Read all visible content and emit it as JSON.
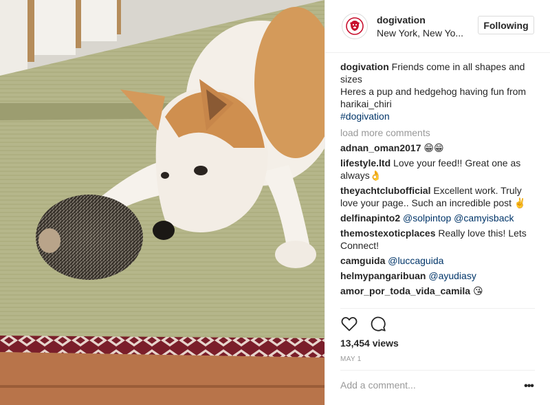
{
  "header": {
    "username": "dogivation",
    "location": "New York, New Yo...",
    "follow_label": "Following",
    "avatar_icon": "dog-logo-icon",
    "brand_color": "#c8102e"
  },
  "caption": {
    "username": "dogivation",
    "line1": "Friends come in all shapes and sizes",
    "line2": "Heres a pup and hedgehog having fun from harikai_chiri",
    "hashtag": "#dogivation"
  },
  "load_more": "load more comments",
  "comments": [
    {
      "user": "adnan_oman2017",
      "text": "😁😁"
    },
    {
      "user": "lifestyle.ltd",
      "text": "Love your feed!! Great one as always👌"
    },
    {
      "user": "theyachtclubofficial",
      "text": "Excellent work. Truly love your page.. Such an incredible post ✌️"
    },
    {
      "user": "delfinapinto2",
      "text": "@solpintop @camyisback"
    },
    {
      "user": "themostexoticplaces",
      "text": "Really love this! Lets Connect!"
    },
    {
      "user": "camguida",
      "text": "@luccaguida"
    },
    {
      "user": "helmypangaribuan",
      "text": "@ayudiasy"
    },
    {
      "user": "amor_por_toda_vida_camila",
      "text": "😘"
    }
  ],
  "actions": {
    "like_icon": "heart-icon",
    "comment_icon": "comment-bubble-icon"
  },
  "views": "13,454 views",
  "date": "MAY 1",
  "add_comment_placeholder": "Add a comment...",
  "more_label": "•••",
  "colors": {
    "text": "#262626",
    "muted": "#999999",
    "link": "#003569",
    "border": "#dbdbdb"
  }
}
